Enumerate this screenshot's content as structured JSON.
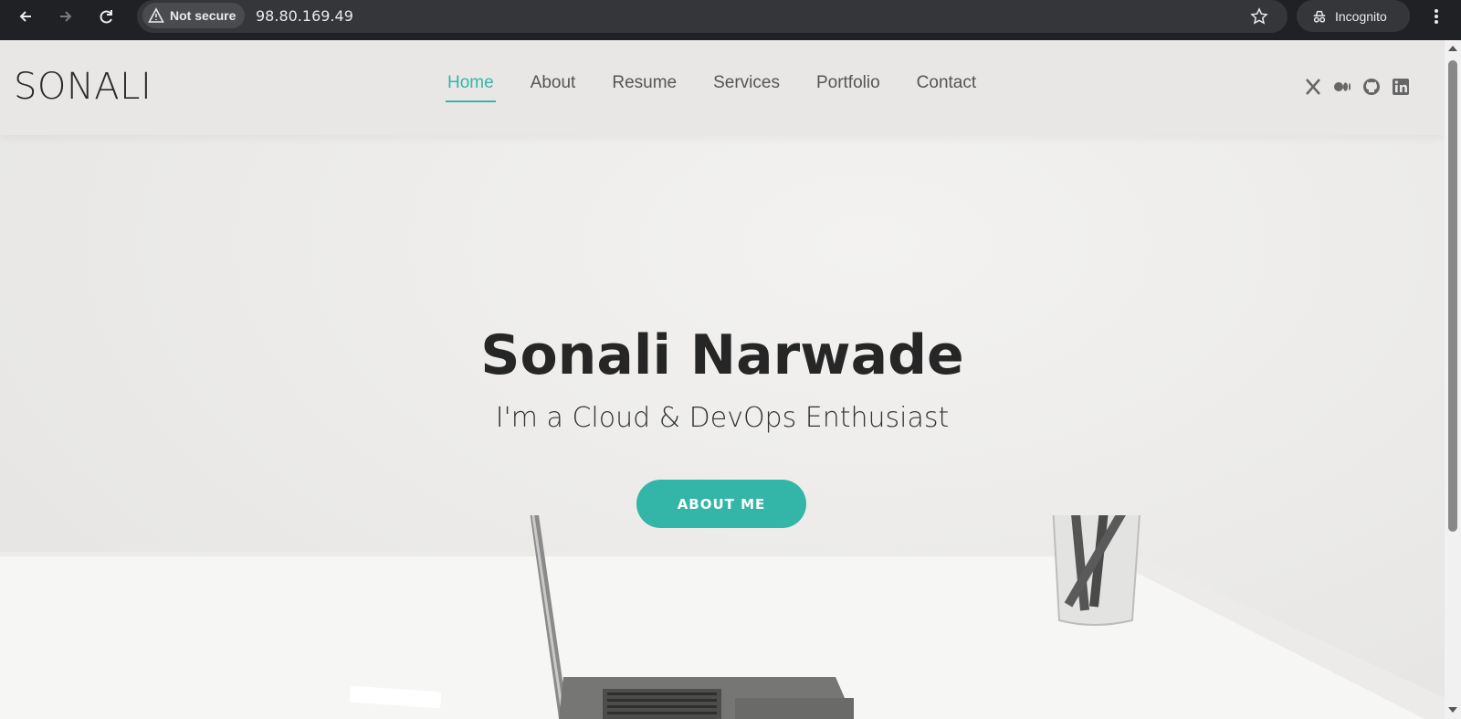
{
  "browser": {
    "security_label": "Not secure",
    "url": "98.80.169.49",
    "incognito_label": "Incognito"
  },
  "site": {
    "logo": "SONALI",
    "nav": [
      {
        "label": "Home",
        "active": true
      },
      {
        "label": "About"
      },
      {
        "label": "Resume"
      },
      {
        "label": "Services"
      },
      {
        "label": "Portfolio"
      },
      {
        "label": "Contact"
      }
    ],
    "socials": [
      "x-twitter-icon",
      "medium-icon",
      "github-icon",
      "linkedin-icon"
    ],
    "accent_color": "#34b7a7"
  },
  "hero": {
    "title": "Sonali Narwade",
    "subtitle": "I'm a Cloud & DevOps Enthusiast",
    "button_label": "ABOUT ME"
  }
}
